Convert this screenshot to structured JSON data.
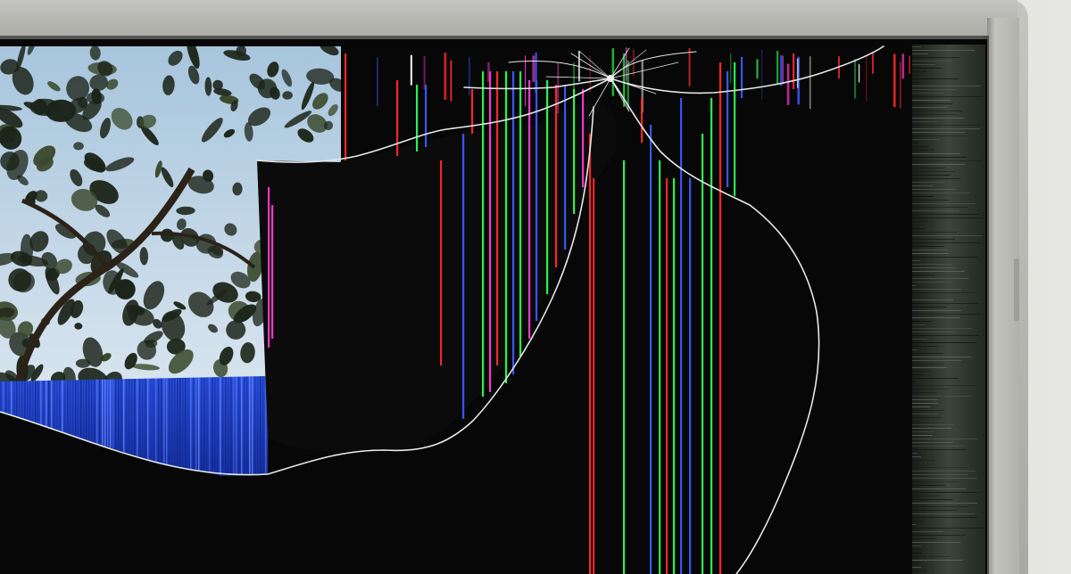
{
  "photo": {
    "subject": "photograph",
    "colors": {
      "wall": "#dcdcd8",
      "bezel": "#b9bab5",
      "bezel_shadow": "#8e8f8a",
      "screen_dark": "#070707",
      "sky": "#b8d2e4",
      "foliage": "#1f2a1c",
      "blue_band": "#1d3fc8",
      "crack": "#e9ebec"
    },
    "stripe_colors": [
      "#ff2a2a",
      "#2bff52",
      "#3b5bff",
      "#ff3bd2",
      "#ffffff"
    ]
  }
}
